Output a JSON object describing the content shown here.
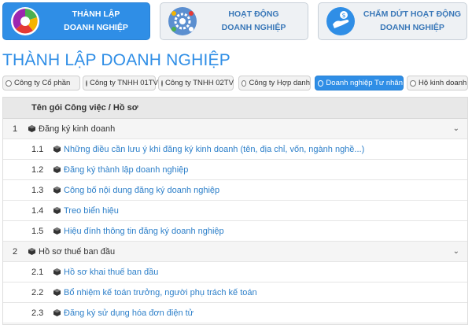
{
  "cards": [
    {
      "label_line1": "THÀNH LẬP",
      "label_line2": "DOANH NGHIỆP",
      "icon": "pie-chart-icon"
    },
    {
      "label_line1": "HOẠT ĐỘNG",
      "label_line2": "DOANH NGHIỆP",
      "icon": "gear-team-icon"
    },
    {
      "label_line1": "CHẤM DỨT HOẠT ĐỘNG",
      "label_line2": "DOANH NGHIỆP",
      "icon": "hand-money-icon"
    }
  ],
  "page_title": "THÀNH LẬP DOANH NGHIỆP",
  "tabs": [
    {
      "label": "Công ty Cổ phần"
    },
    {
      "label": "Công ty TNHH 01TV"
    },
    {
      "label": "Công ty TNHH 02TV"
    },
    {
      "label": "Công ty Hợp danh"
    },
    {
      "label": "Doanh nghiệp Tư nhân"
    },
    {
      "label": "Hộ kinh doanh"
    }
  ],
  "selected_tab": "Doanh nghiệp Tư nhân",
  "table": {
    "header": "Tên gói Công việc / Hồ sơ",
    "groups": [
      {
        "num": "1",
        "label": "Đăng ký kinh doanh",
        "items": [
          {
            "num": "1.1",
            "label": "Những điều cần lưu ý khi đăng ký kinh doanh (tên, địa chỉ, vốn, ngành nghề...)"
          },
          {
            "num": "1.2",
            "label": "Đăng ký thành lập doanh nghiệp"
          },
          {
            "num": "1.3",
            "label": "Công bố nội dung đăng ký doanh nghiệp"
          },
          {
            "num": "1.4",
            "label": "Treo biển hiệu"
          },
          {
            "num": "1.5",
            "label": "Hiệu đính thông tin đăng ký doanh nghiệp"
          }
        ]
      },
      {
        "num": "2",
        "label": "Hồ sơ thuế ban đầu",
        "items": [
          {
            "num": "2.1",
            "label": "Hồ sơ khai thuế ban đầu"
          },
          {
            "num": "2.2",
            "label": "Bổ nhiệm kế toán trưởng, người phụ trách kế toán"
          },
          {
            "num": "2.3",
            "label": "Đăng ký sử dụng hóa đơn điện tử"
          }
        ]
      }
    ]
  },
  "colors": {
    "accent": "#2f8ee6",
    "link": "#2c7fc9"
  }
}
